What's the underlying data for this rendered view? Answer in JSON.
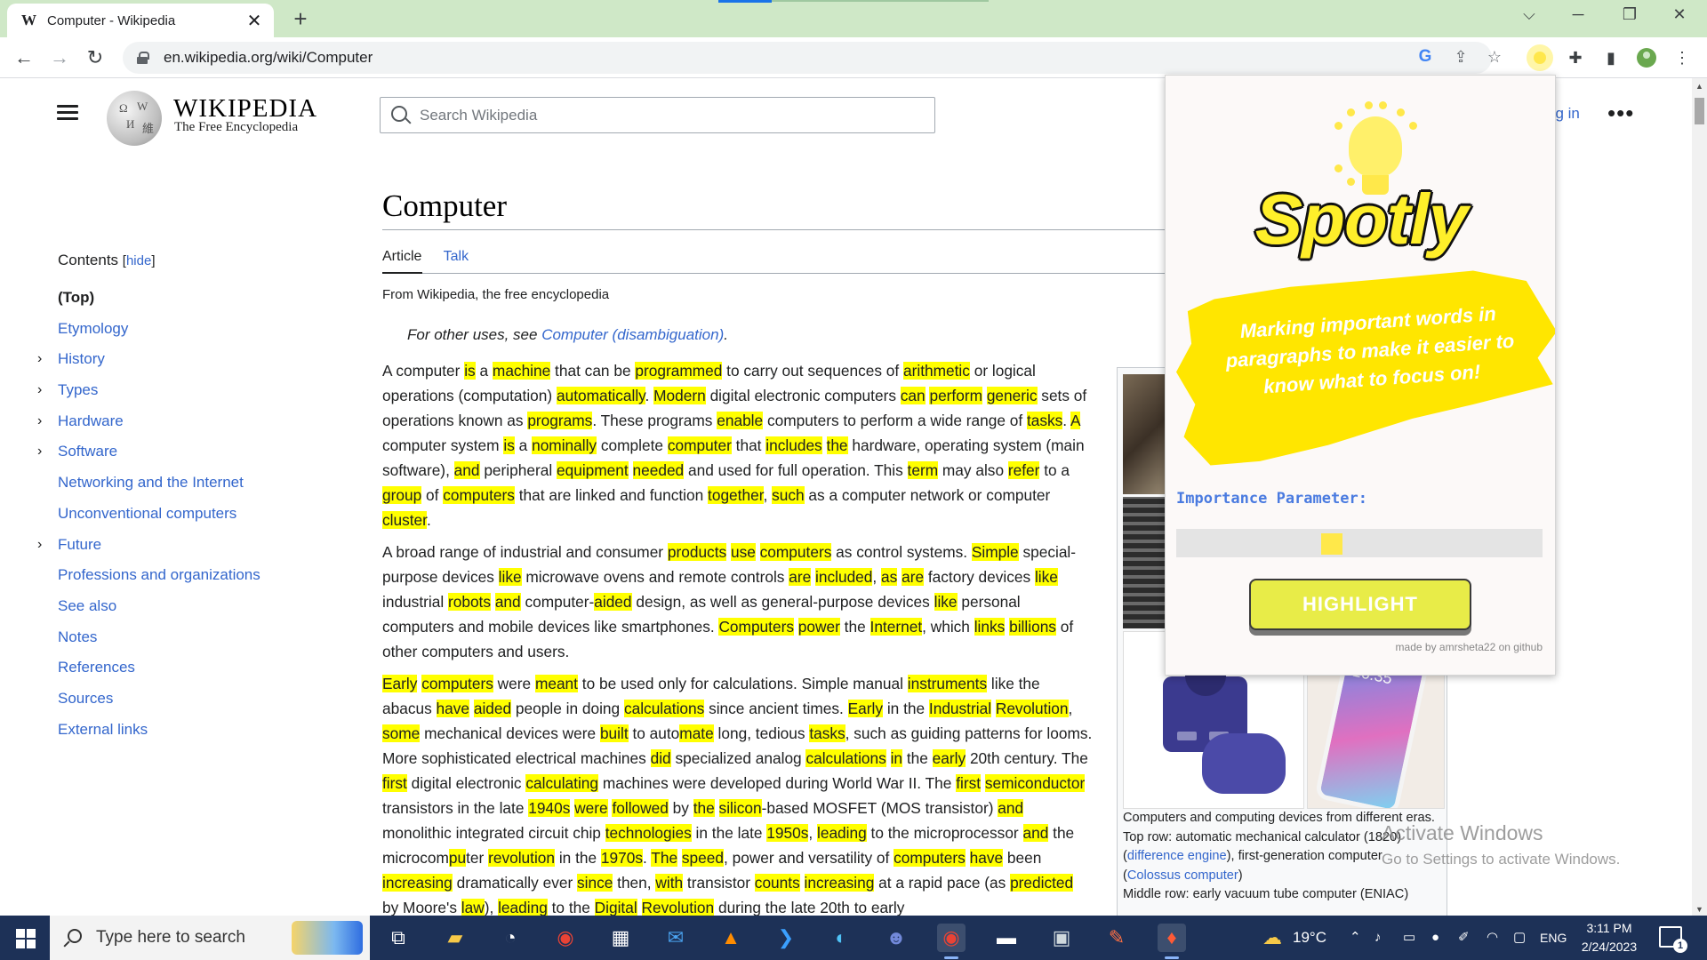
{
  "browser": {
    "tab_title": "Computer - Wikipedia",
    "tab_favicon": "W",
    "url": "en.wikipedia.org/wiki/Computer",
    "google_icon": "G"
  },
  "wiki": {
    "wordmark": "WIKIPEDIA",
    "tagline": "The Free Encyclopedia",
    "search_placeholder": "Search Wikipedia",
    "login": "Log in",
    "login_visible": "og in",
    "more": "•••",
    "contents_title": "Contents",
    "contents_hide": "hide",
    "toc": [
      {
        "label": "(Top)",
        "expandable": false,
        "top": true
      },
      {
        "label": "Etymology",
        "expandable": false
      },
      {
        "label": "History",
        "expandable": true
      },
      {
        "label": "Types",
        "expandable": true
      },
      {
        "label": "Hardware",
        "expandable": true
      },
      {
        "label": "Software",
        "expandable": true
      },
      {
        "label": "Networking and the Internet",
        "expandable": false
      },
      {
        "label": "Unconventional computers",
        "expandable": false
      },
      {
        "label": "Future",
        "expandable": true
      },
      {
        "label": "Professions and organizations",
        "expandable": false
      },
      {
        "label": "See also",
        "expandable": false
      },
      {
        "label": "Notes",
        "expandable": false
      },
      {
        "label": "References",
        "expandable": false
      },
      {
        "label": "Sources",
        "expandable": false
      },
      {
        "label": "External links",
        "expandable": false
      }
    ],
    "article_title": "Computer",
    "tab_article": "Article",
    "tab_talk": "Talk",
    "from": "From Wikipedia, the free encyclopedia",
    "hatnote_prefix": "For other uses, see ",
    "hatnote_link": "Computer (disambiguation)",
    "hatnote_suffix": ".",
    "paragraphs": [
      "A computer [[is]] a [[machine]] that can be [[programmed]] to carry out sequences of [[arithmetic]] or logical operations (computation) [[automatically]]. [[Modern]] digital electronic computers [[can]] [[perform]] [[generic]] sets of operations known as [[programs]]. These programs [[enable]] computers to perform a wide range of [[tasks]]. [[A]] computer system [[is]] a [[nominally]] complete [[computer]] that [[includes]] [[the]] hardware, operating system (main software), [[and]] peripheral [[equipment]] [[needed]] and used for full operation. This [[term]] may also [[refer]] to a [[group]] of [[computers]] that are linked and function [[together]], [[such]] as a computer network or computer [[cluster]].",
      "A broad range of industrial and consumer [[products]] [[use]] [[computers]] as control systems. [[Simple]] special-purpose devices [[like]] microwave ovens and remote controls [[are]] [[included]], [[as]] [[are]] factory devices [[like]] industrial [[robots]] [[and]] computer-[[aided]] design, as well as general-purpose devices [[like]] personal computers and mobile devices like smartphones. [[Computers]] [[power]] the [[Internet]], which [[links]] [[billions]] of other computers and users.",
      "[[Early]] [[computers]] were [[meant]] to be used only for calculations. Simple manual [[instruments]] like the abacus [[have]] [[aided]] people in doing [[calculations]] since ancient times. [[Early]] in the [[Industrial]] [[Revolution]], [[some]] mechanical devices were [[built]] to auto[[mate]] long, tedious [[tasks]], such as guiding patterns for looms. More sophisticated electrical machines [[did]] specialized analog [[calculations]] [[in]] the [[early]] 20th century. The [[first]] digital electronic [[calculating]] machines were developed during World War II. The [[first]] [[semiconductor]] transistors in the late [[1940s]] [[were]] [[followed]] by [[the]] [[silicon]]-based MOSFET (MOS transistor) [[and]] monolithic integrated circuit chip [[technologies]] in the late [[1950s]], [[leading]] to the microprocessor [[and]] the microcom[[pu]]ter [[revolution]] in the [[1970s]]. [[The]] [[speed]], power and versatility of [[computers]] [[have]] been [[increasing]] dramatically ever [[since]] then, [[with]] transistor [[counts]] [[increasing]] at a rapid pace (as [[predicted]] by Moore's [[law]]), [[leading]] to the [[Digital]] [[Revolution]] during the late 20th to early"
    ],
    "caption_line1": "Computers and computing devices from different eras.",
    "caption_line2_prefix": "Top row: automatic mechanical calculator (1820) (",
    "caption_link1": "difference engine",
    "caption_line2_mid": "), first-generation computer (",
    "caption_link2": "Colossus computer",
    "caption_line2_suffix": ")",
    "caption_line3": "Middle row: early vacuum tube computer (ENIAC)",
    "phone_time": "16:35"
  },
  "spotly": {
    "brand": "Spotly",
    "tagline": "Marking important words in paragraphs  to make it easier to know what to focus on!",
    "param_label": "Importance Parameter:",
    "slider_value": 0.42,
    "button": "HIGHLIGHT",
    "credit": "made by amrsheta22 on github",
    "accent": "#ffe600"
  },
  "watermark": {
    "line1": "Activate Windows",
    "line2": "Go to Settings to activate Windows."
  },
  "taskbar": {
    "search_placeholder": "Type here to search",
    "temperature": "19°C",
    "language": "ENG",
    "time": "3:11 PM",
    "date": "2/24/2023",
    "notification_count": "1"
  },
  "colors": {
    "highlight": "#ffff00",
    "link": "#3366cc",
    "tabbar": "#cfe8c7",
    "taskbar": "#1d3157"
  }
}
